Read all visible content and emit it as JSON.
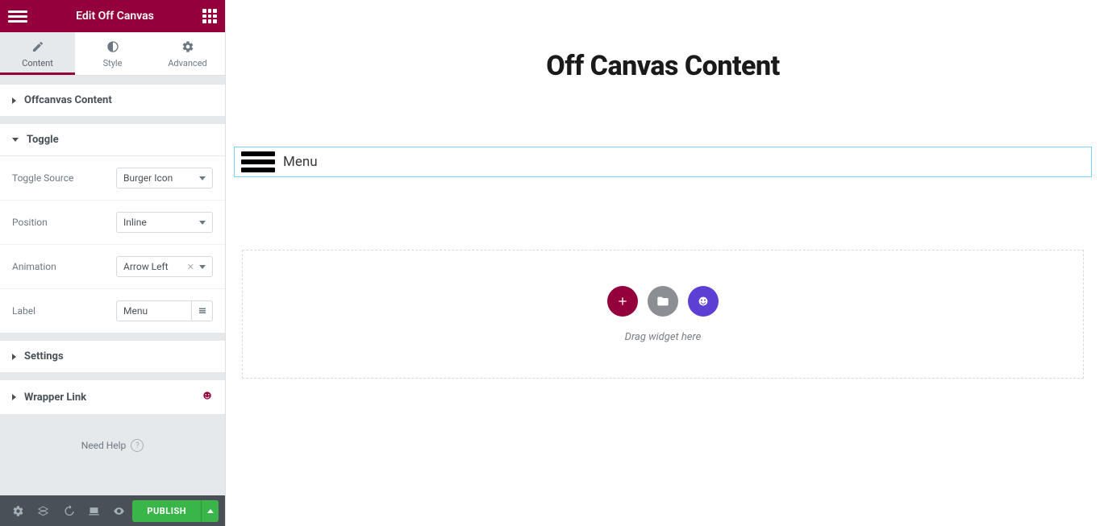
{
  "header": {
    "title": "Edit Off Canvas"
  },
  "tabs": {
    "content": "Content",
    "style": "Style",
    "advanced": "Advanced"
  },
  "sections": {
    "offcanvas_content": "Offcanvas Content",
    "toggle": "Toggle",
    "settings": "Settings",
    "wrapper_link": "Wrapper Link"
  },
  "toggle_controls": {
    "toggle_source": {
      "label": "Toggle Source",
      "value": "Burger Icon"
    },
    "position": {
      "label": "Position",
      "value": "Inline"
    },
    "animation": {
      "label": "Animation",
      "value": "Arrow Left"
    },
    "label_field": {
      "label": "Label",
      "value": "Menu"
    }
  },
  "help": {
    "text": "Need Help"
  },
  "footer": {
    "publish": "PUBLISH"
  },
  "canvas": {
    "title": "Off Canvas Content",
    "widget_label": "Menu",
    "drop_text": "Drag widget here"
  }
}
